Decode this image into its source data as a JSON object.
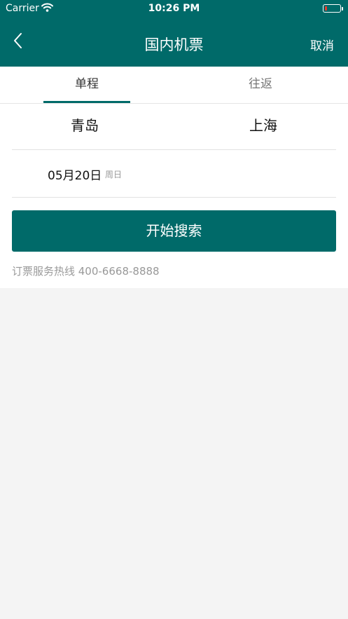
{
  "status_bar": {
    "carrier": "Carrier",
    "time": "10:26 PM",
    "battery_color": "#e43a2d"
  },
  "nav": {
    "title": "国内机票",
    "cancel_label": "取消",
    "back_icon": "chevron-left-icon"
  },
  "tabs": [
    {
      "label": "单程",
      "active": true
    },
    {
      "label": "往返",
      "active": false
    }
  ],
  "trip": {
    "from_city": "青岛",
    "to_city": "上海",
    "date": "05月20日",
    "weekday": "周日"
  },
  "search_label": "开始搜索",
  "hotline": "订票服务热线 400-6668-8888",
  "colors": {
    "brand": "#006a69",
    "background": "#f4f4f4"
  }
}
